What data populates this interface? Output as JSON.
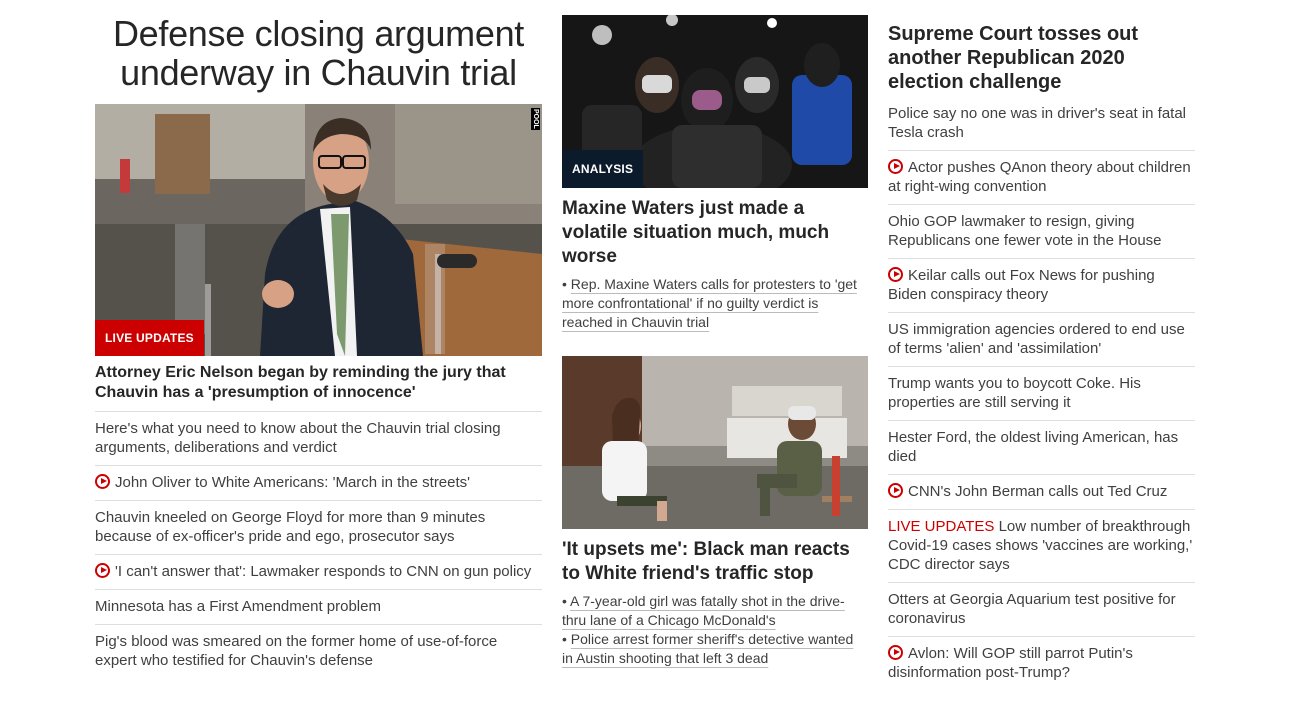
{
  "left": {
    "headline": "Defense closing argument underway in Chauvin trial",
    "image_credit": "POOL",
    "badge": "LIVE UPDATES",
    "lead_story": "Attorney Eric Nelson began by reminding the jury that Chauvin has a 'presumption of innocence'",
    "items": [
      {
        "text": "Here's what you need to know about the Chauvin trial closing arguments, deliberations and verdict",
        "video": false
      },
      {
        "text": "John Oliver to White Americans: 'March in the streets'",
        "video": true
      },
      {
        "text": "Chauvin kneeled on George Floyd for more than 9 minutes because of ex-officer's pride and ego, prosecutor says",
        "video": false
      },
      {
        "text": "'I can't answer that': Lawmaker responds to CNN on gun policy",
        "video": true
      },
      {
        "text": "Minnesota has a First Amendment problem",
        "video": false
      },
      {
        "text": "Pig's blood was smeared on the former home of use-of-force expert who testified for Chauvin's defense",
        "video": false
      }
    ]
  },
  "mid": {
    "story1": {
      "badge": "ANALYSIS",
      "title": "Maxine Waters just made a volatile situation much, much worse",
      "bullets": [
        "Rep. Maxine Waters calls for protesters to 'get more confrontational' if no guilty verdict is reached in Chauvin trial"
      ]
    },
    "story2": {
      "title": "'It upsets me': Black man reacts to White friend's traffic stop",
      "bullets": [
        "A 7-year-old girl was fatally shot in the drive-thru lane of a Chicago McDonald's",
        "Police arrest former sheriff's detective wanted in Austin shooting that left 3 dead"
      ]
    }
  },
  "right": {
    "title": "Supreme Court tosses out another Republican 2020 election challenge",
    "items": [
      {
        "text": "Police say no one was in driver's seat in fatal Tesla crash",
        "video": false,
        "live": ""
      },
      {
        "text": "Actor pushes QAnon theory about children at right-wing convention",
        "video": true,
        "live": ""
      },
      {
        "text": "Ohio GOP lawmaker to resign, giving Republicans one fewer vote in the House",
        "video": false,
        "live": ""
      },
      {
        "text": "Keilar calls out Fox News for pushing Biden conspiracy theory",
        "video": true,
        "live": ""
      },
      {
        "text": "US immigration agencies ordered to end use of terms 'alien' and 'assimilation'",
        "video": false,
        "live": ""
      },
      {
        "text": "Trump wants you to boycott Coke. His properties are still serving it",
        "video": false,
        "live": ""
      },
      {
        "text": "Hester Ford, the oldest living American, has died",
        "video": false,
        "live": ""
      },
      {
        "text": "CNN's John Berman calls out Ted Cruz",
        "video": true,
        "live": ""
      },
      {
        "text": "Low number of breakthrough Covid-19 cases shows 'vaccines are working,' CDC director says",
        "video": false,
        "live": "LIVE UPDATES"
      },
      {
        "text": "Otters at Georgia Aquarium test positive for coronavirus",
        "video": false,
        "live": ""
      },
      {
        "text": "Avlon: Will GOP still parrot Putin's disinformation post-Trump?",
        "video": true,
        "live": ""
      }
    ]
  },
  "colors": {
    "accent": "#cc0000",
    "analysis_badge": "#0c1b2b"
  }
}
